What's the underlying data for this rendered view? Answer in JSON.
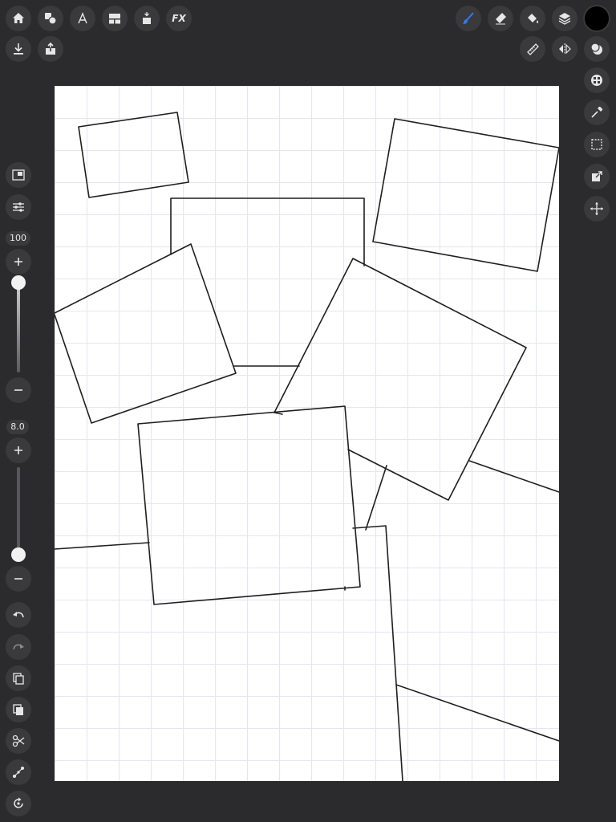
{
  "toolbar": {
    "left_tools": [
      {
        "name": "gallery",
        "icon": "home-icon"
      },
      {
        "name": "shapes",
        "icon": "shapes-icon"
      },
      {
        "name": "text",
        "icon": "text-icon"
      },
      {
        "name": "layout",
        "icon": "layout-icon"
      },
      {
        "name": "adjust",
        "icon": "magic-wand-icon"
      },
      {
        "name": "effects",
        "icon": "fx-icon",
        "label": "FX"
      }
    ],
    "file_tools": [
      {
        "name": "download",
        "icon": "download-icon"
      },
      {
        "name": "share",
        "icon": "share-icon"
      }
    ],
    "right_tools": [
      {
        "name": "brush",
        "icon": "brush-icon",
        "active": true
      },
      {
        "name": "eraser",
        "icon": "eraser-icon"
      },
      {
        "name": "fill",
        "icon": "fill-bucket-icon"
      },
      {
        "name": "layers",
        "icon": "layers-icon"
      }
    ],
    "current_color": "#000000",
    "guide_tools": [
      {
        "name": "ruler",
        "icon": "ruler-icon"
      },
      {
        "name": "symmetry",
        "icon": "symmetry-icon"
      },
      {
        "name": "blend",
        "icon": "blend-icon"
      }
    ]
  },
  "right_sidebar": [
    {
      "name": "texture",
      "icon": "texture-icon"
    },
    {
      "name": "eyedropper",
      "icon": "eyedropper-icon"
    },
    {
      "name": "selection",
      "icon": "selection-icon"
    },
    {
      "name": "transform",
      "icon": "transform-icon"
    },
    {
      "name": "move",
      "icon": "move-icon"
    }
  ],
  "left_sidebar": {
    "top_buttons": [
      {
        "name": "reference",
        "icon": "reference-icon"
      },
      {
        "name": "brush-settings",
        "icon": "sliders-icon"
      }
    ],
    "opacity": {
      "label": "100",
      "value": 1.0
    },
    "size": {
      "label": "8.0",
      "value": 0.08
    },
    "bottom_buttons": [
      {
        "name": "undo",
        "icon": "undo-icon"
      },
      {
        "name": "redo",
        "icon": "redo-icon"
      },
      {
        "name": "duplicate",
        "icon": "duplicate-icon"
      },
      {
        "name": "paste",
        "icon": "paste-icon"
      },
      {
        "name": "cut",
        "icon": "scissors-icon"
      },
      {
        "name": "transform-node",
        "icon": "node-icon"
      },
      {
        "name": "rotate",
        "icon": "rotate-icon"
      }
    ]
  },
  "colors": {
    "background": "#2b2b2d",
    "button": "#3a3a3c",
    "icon": "#e6e6e6",
    "accent": "#2f7cf6",
    "canvas": "#ffffff",
    "grid": "#e4e6f2",
    "stroke": "#1f1f1f"
  }
}
